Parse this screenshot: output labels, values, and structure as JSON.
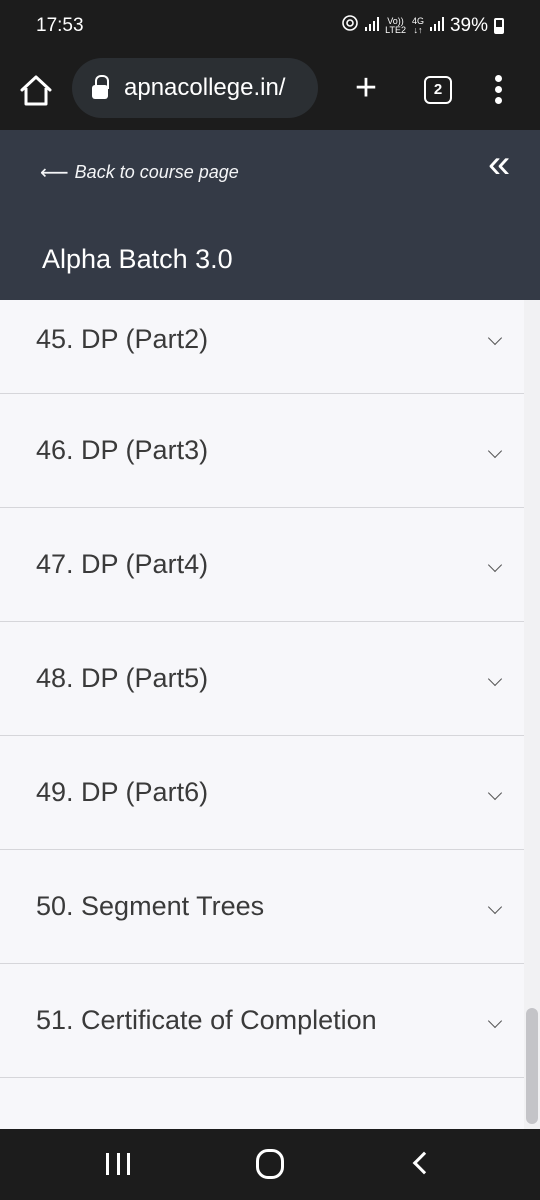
{
  "status_bar": {
    "time": "17:53",
    "network_top": "Vo))",
    "network_bottom": "LTE2",
    "net4g_top": "4G",
    "net4g_bottom": "↓↑",
    "battery": "39%"
  },
  "browser": {
    "url": "apnacollege.in/",
    "tab_count": "2",
    "icons": [
      "home-icon",
      "lock-icon",
      "plus-icon",
      "tabs-icon",
      "more-icon"
    ]
  },
  "course": {
    "back_label": "Back to course page",
    "collapse_icon": "«",
    "title": "Alpha Batch 3.0"
  },
  "lessons": [
    {
      "label": "45. DP (Part2)"
    },
    {
      "label": "46. DP (Part3)"
    },
    {
      "label": "47. DP (Part4)"
    },
    {
      "label": "48. DP (Part5)"
    },
    {
      "label": "49. DP (Part6)"
    },
    {
      "label": "50. Segment Trees"
    },
    {
      "label": "51. Certificate of Completion"
    }
  ],
  "colors": {
    "header_bg": "#343a46",
    "list_bg": "#f7f7fa",
    "system_bar": "#1c1c1c"
  }
}
